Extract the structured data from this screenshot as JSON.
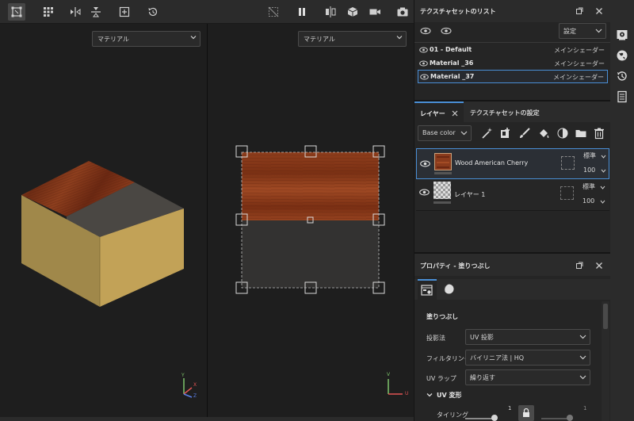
{
  "viewport_left": {
    "material_select": "マテリアル"
  },
  "viewport_right": {
    "material_select": "マテリアル"
  },
  "texture_set_list": {
    "title": "テクスチャセットのリスト",
    "settings_label": "設定",
    "items": [
      {
        "name": "01 - Default",
        "shader": "メインシェーダー"
      },
      {
        "name": "Material _36",
        "shader": "メインシェーダー"
      },
      {
        "name": "Material _37",
        "shader": "メインシェーダー"
      }
    ]
  },
  "layers_panel": {
    "tab_layers": "レイヤー",
    "tab_texture_settings": "テクスチャセットの設定",
    "channel_select": "Base color",
    "layers": [
      {
        "name": "Wood American Cherry",
        "blend": "標準",
        "opacity": "100"
      },
      {
        "name": "レイヤー 1",
        "blend": "標準",
        "opacity": "100"
      }
    ]
  },
  "properties": {
    "title": "プロパティ - 塗りつぶし",
    "section_title": "塗りつぶし",
    "projection_label": "投影法",
    "projection_value": "UV 投影",
    "filtering_label": "フィルタリング",
    "filtering_value": "バイリニア法 | HQ",
    "uv_wrap_label": "UV ラップ",
    "uv_wrap_value": "繰り返す",
    "uv_transform_label": "UV 変形",
    "tiling_label": "タイリング",
    "tiling_value_1": "1",
    "tiling_value_2": "1"
  },
  "axes": {
    "x": "X",
    "y": "Y",
    "z": "Z",
    "u": "U",
    "v": "V"
  },
  "colors": {
    "accent": "#4a8fd6",
    "wood": "#8a3b1c",
    "panel": "#252525"
  }
}
